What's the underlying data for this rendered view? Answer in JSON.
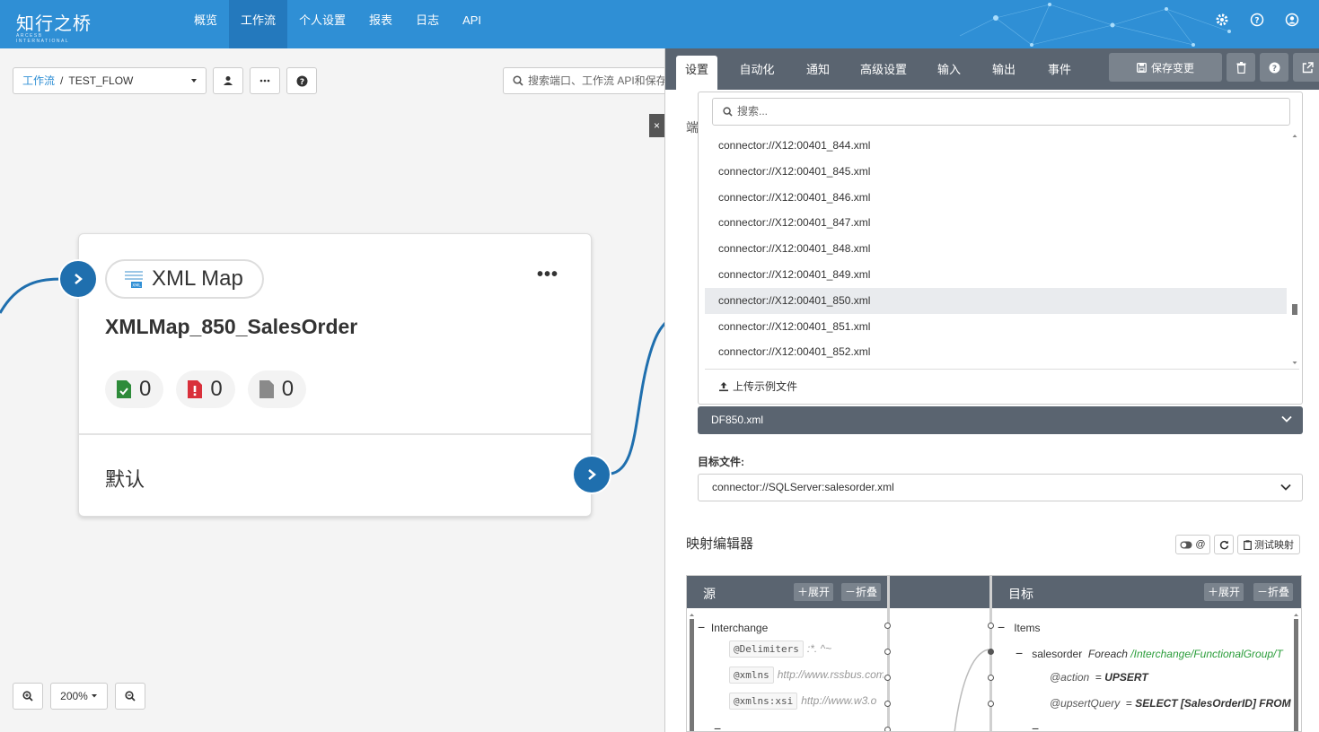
{
  "topnav": {
    "logo_text": "知行之桥",
    "logo_sub": "ARCESB INTERNATIONAL",
    "items": [
      {
        "label": "概览"
      },
      {
        "label": "工作流"
      },
      {
        "label": "个人设置"
      },
      {
        "label": "报表"
      },
      {
        "label": "日志"
      },
      {
        "label": "API"
      }
    ],
    "active_index": 1,
    "right_icons": [
      "gear-icon",
      "help-icon",
      "user-icon"
    ]
  },
  "canvas": {
    "breadcrumb_link": "工作流",
    "breadcrumb_sep": "/",
    "breadcrumb_current": "TEST_FLOW",
    "search_placeholder": "搜索端口、工作流 API和保存",
    "close_label": "×",
    "node": {
      "type_label": "XML Map",
      "title": "XMLMap_850_SalesOrder",
      "menu_label": "•••",
      "counts": [
        {
          "kind": "success",
          "value": "0"
        },
        {
          "kind": "error",
          "value": "0"
        },
        {
          "kind": "pending",
          "value": "0"
        }
      ],
      "output_label": "默认"
    },
    "zoom_level": "200%"
  },
  "panel": {
    "tabs": [
      "设置",
      "自动化",
      "通知",
      "高级设置",
      "输入",
      "输出",
      "事件"
    ],
    "active_tab": 0,
    "save_label": "保存变更",
    "side_label": "端",
    "dropdown": {
      "search_placeholder": "搜索...",
      "items": [
        "connector://X12:00401_844.xml",
        "connector://X12:00401_845.xml",
        "connector://X12:00401_846.xml",
        "connector://X12:00401_847.xml",
        "connector://X12:00401_848.xml",
        "connector://X12:00401_849.xml",
        "connector://X12:00401_850.xml",
        "connector://X12:00401_851.xml",
        "connector://X12:00401_852.xml"
      ],
      "selected_index": 6,
      "upload_label": "上传示例文件"
    },
    "source_file_value": "DF850.xml",
    "target_label": "目标文件:",
    "target_file_value": "connector://SQLServer:salesorder.xml",
    "mapping_title": "映射编辑器",
    "toggle_label": "@",
    "test_label": "测试映射",
    "source": {
      "title": "源",
      "expand": "展开",
      "collapse": "折叠",
      "rows": [
        {
          "name": "Interchange"
        },
        {
          "name": "@Delimiters",
          "value": ":*. ^~"
        },
        {
          "name": "@xmlns",
          "value": "http://www.rssbus.com"
        },
        {
          "name": "@xmlns:xsi",
          "value": "http://www.w3.o"
        }
      ]
    },
    "target": {
      "title": "目标",
      "expand": "展开",
      "collapse": "折叠",
      "items_label": "Items",
      "salesorder_label": "salesorder",
      "foreach_kw": "Foreach",
      "foreach_path": "/Interchange/FunctionalGroup/T",
      "action_label": "@action",
      "action_value": "UPSERT",
      "upsert_label": "@upsertQuery",
      "upsert_value": "SELECT [SalesOrderID] FROM"
    }
  }
}
